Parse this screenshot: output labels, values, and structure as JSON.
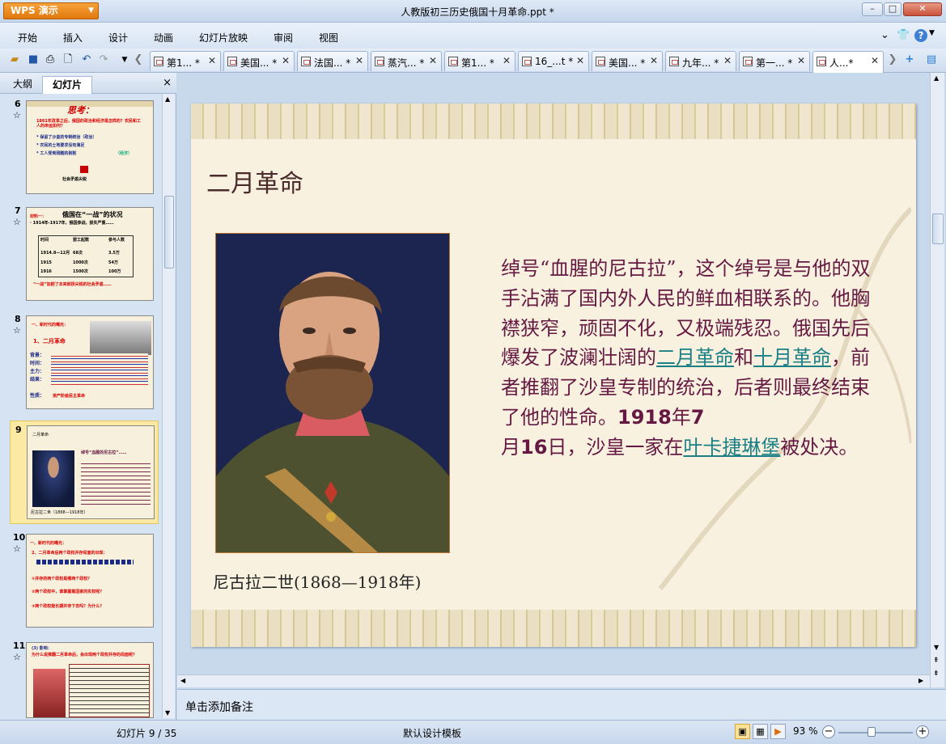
{
  "app": {
    "name": "WPS 演示",
    "doc_title": "人教版初三历史俄国十月革命.ppt *"
  },
  "menu": [
    "开始",
    "插入",
    "设计",
    "动画",
    "幻灯片放映",
    "审阅",
    "视图"
  ],
  "doc_tabs": [
    "第1... *",
    "美国... *",
    "法国... *",
    "蒸汽... *",
    "第1... *",
    "16_...t *",
    "美国... *",
    "九年... *",
    "第一... *",
    "人...*"
  ],
  "panel": {
    "tab_outline": "大纲",
    "tab_slides": "幻灯片",
    "close": "×"
  },
  "thumbnails": [
    {
      "num": "6",
      "lines": [
        "思考：",
        "1861年改革之后，俄国的政治和经济是怎样的？农民和工人的命运如何？",
        "* 保留了沙皇的专制统治（政治）",
        "* 农民的土地要求没有满足",
        "* 工人受到残酷的剥削",
        "（经济）",
        "社会矛盾尖锐"
      ]
    },
    {
      "num": "7",
      "lines": [
        "俄国在“一战”的状况",
        "材料一：",
        "· 1914年-1917年，俄国参战，损失严重……",
        "时间",
        "罢工起数",
        "参与人数",
        "1914.8—12月",
        "68次",
        "3.5万",
        "1915",
        "1000次",
        "54万",
        "1916",
        "1500次",
        "100万",
        "“一战”加剧了本来就很尖锐的社会矛盾……"
      ]
    },
    {
      "num": "8",
      "lines": [
        "一、新时代的曙光：",
        "1、二月革命",
        "背景：",
        "时间：",
        "主力：",
        "结果：",
        "性质：",
        "资产阶级民主革命"
      ]
    },
    {
      "num": "9",
      "lines": [
        "二月革命",
        "绰号“血腥的尼古拉”……",
        "尼古拉二世（1868—1918年）"
      ]
    },
    {
      "num": "10",
      "lines": [
        "一、新时代的曙光：",
        "2、二月革命后两个政权并存局面的出现：",
        "①并存的两个政权是哪两个政权？",
        "②两个政权中，谁掌握着国家的实权呢？",
        "③两个政权能长期并存下去吗？为什么？"
      ]
    },
    {
      "num": "11",
      "lines": [
        "(3) 影响：",
        "为什么说推翻二月革命后，会出现两个政权并存的局面呢？"
      ]
    }
  ],
  "slide": {
    "title": "二月革命",
    "caption": "尼古拉二世(1868—1918年)",
    "body_1": "绰号“血腥的尼古拉”，这个绰号是与他的双手沾满了国内外人民的鲜血相联系的。他胸襟狭窄，顽固不化，又极端残忍。俄国先后爆发了波澜壮阔的",
    "link_1": "二月革命",
    "body_2": "和",
    "link_2": "十月革命",
    "body_3": "，前者推翻了沙皇专制的统治，后者则最终结束了他的性命。",
    "year": "1918",
    "nian": "年",
    "month": "7",
    "yue": "月",
    "day": "16",
    "body_4": "日，沙皇一家在",
    "link_3": "叶卡捷琳堡",
    "body_5": "被处决。"
  },
  "notes": "单击添加备注",
  "status": {
    "slide_counter": "幻灯片 9 / 35",
    "template": "默认设计模板",
    "zoom": "93 %"
  },
  "colors": {
    "body_text": "#651942",
    "link": "#1b7f86",
    "selected_thumb": "#fbe9a4"
  },
  "icons": [
    "open-icon",
    "save-icon",
    "print-icon",
    "preview-icon",
    "undo-icon",
    "redo-icon",
    "normal-view-icon",
    "sorter-view-icon",
    "slideshow-icon"
  ]
}
